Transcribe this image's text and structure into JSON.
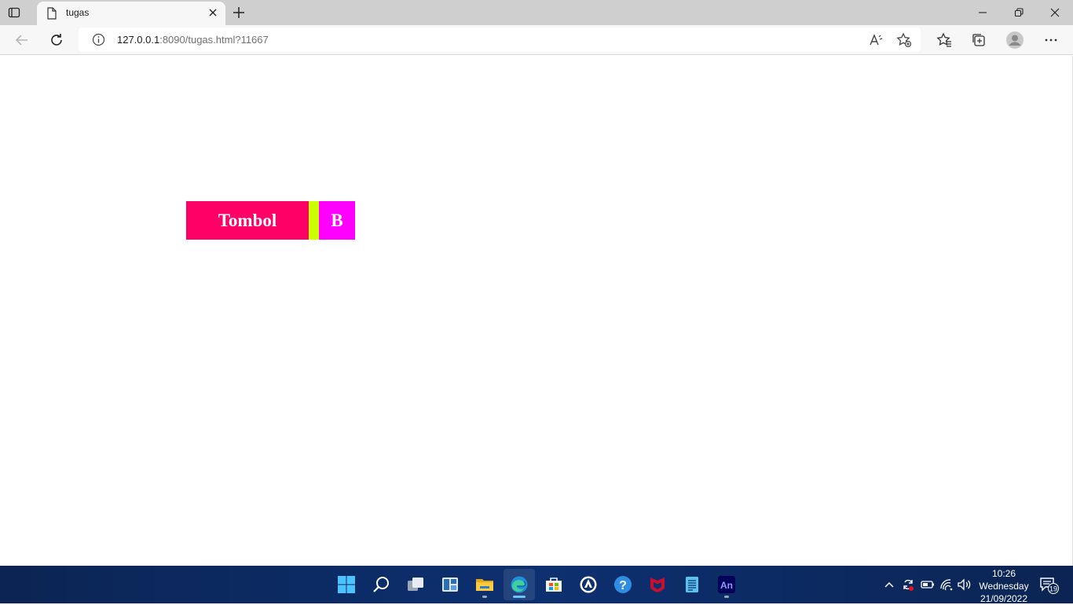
{
  "browser": {
    "tab_title": "tugas",
    "url_host": "127.0.0.1",
    "url_rest": ":8090/tugas.html?11667"
  },
  "page": {
    "button_tombol_label": "Tombol",
    "button_b_label": "B",
    "colors": {
      "tombol_bg": "#ff0066",
      "middle_bg": "#ccff00",
      "b_bg": "#ff00ff"
    }
  },
  "taskbar": {
    "apps": [
      "start-icon",
      "search-icon",
      "task-view-icon",
      "widgets-icon",
      "file-explorer-icon",
      "edge-icon",
      "microsoft-store-icon",
      "app-icon",
      "help-icon",
      "mcafee-icon",
      "notepad-icon",
      "animate-icon"
    ],
    "animate_label": "An",
    "time": "10:26",
    "day": "Wednesday",
    "date": "21/09/2022",
    "notification_count": "19"
  }
}
